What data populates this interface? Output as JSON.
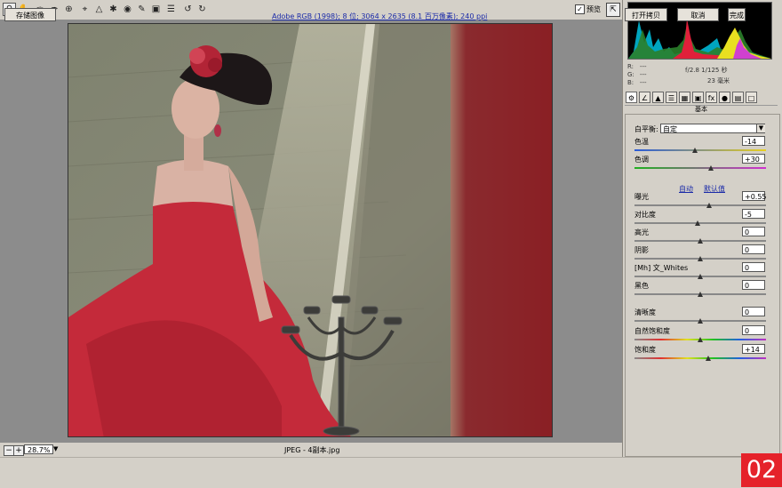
{
  "toolbar": {
    "tools": [
      "zoom-icon",
      "hand-icon",
      "white-balance-icon",
      "color-sampler-icon",
      "target-adjust-icon",
      "crop-icon",
      "straighten-icon",
      "spot-removal-icon",
      "red-eye-icon",
      "adjustment-brush-icon",
      "graduated-filter-icon",
      "preferences-icon",
      "list-icon",
      "rotate-left-icon",
      "rotate-right-icon"
    ],
    "preview_checked": "✓",
    "preview_label": "预览"
  },
  "canvas": {
    "zoom_value": "28.7%",
    "file_info": "JPEG - 4副本.jpg"
  },
  "camera_info": {
    "r_label": "R:",
    "r_value": "---",
    "g_label": "G:",
    "g_value": "---",
    "b_label": "B:",
    "b_value": "---",
    "exposure": "f/2.8  1/125 秒",
    "focal": "23 毫米"
  },
  "panel": {
    "title": "基本",
    "white_balance_label": "白平衡:",
    "white_balance_value": "自定",
    "temperature_label": "色温",
    "temperature_value": "-14",
    "temperature_pos": 0.46,
    "tint_label": "色调",
    "tint_value": "+30",
    "tint_pos": 0.58,
    "auto_label": "自动",
    "default_label": "默认值",
    "exposure_label": "曝光",
    "exposure_value": "+0.55",
    "exposure_pos": 0.57,
    "contrast_label": "对比度",
    "contrast_value": "-5",
    "contrast_pos": 0.48,
    "highlights_label": "高光",
    "highlights_value": "0",
    "highlights_pos": 0.5,
    "shadows_label": "阴影",
    "shadows_value": "0",
    "shadows_pos": 0.5,
    "whites_label": "[Mh] 文_Whites",
    "whites_value": "0",
    "whites_pos": 0.5,
    "blacks_label": "黑色",
    "blacks_value": "0",
    "blacks_pos": 0.5,
    "clarity_label": "清晰度",
    "clarity_value": "0",
    "clarity_pos": 0.5,
    "vibrance_label": "自然饱和度",
    "vibrance_value": "0",
    "vibrance_pos": 0.5,
    "saturation_label": "饱和度",
    "saturation_value": "+14",
    "saturation_pos": 0.56
  },
  "footer": {
    "save_label": "存储图像",
    "workflow": "Adobe RGB (1998); 8 位; 3064 x 2635 (8.1 百万像素); 240 ppi",
    "open_label": "打开拷贝",
    "cancel_label": "取消",
    "done_label": "完成",
    "badge": "02"
  },
  "colors": {
    "dress": "#c42a3a",
    "curtain": "#8a1f24",
    "badge": "#e5222a",
    "link": "#1a2aa8"
  }
}
